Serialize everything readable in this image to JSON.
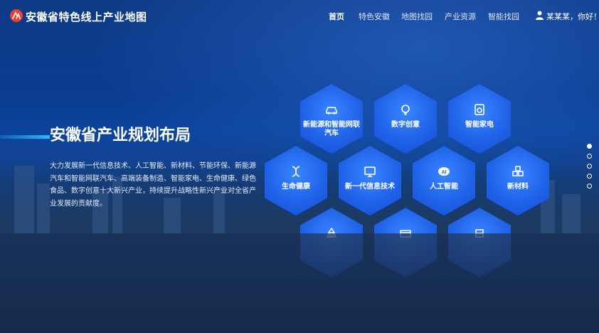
{
  "header": {
    "title": "安徽省特色线上产业地图",
    "nav": [
      {
        "label": "首页",
        "active": true
      },
      {
        "label": "特色安徽",
        "active": false
      },
      {
        "label": "地图找园",
        "active": false
      },
      {
        "label": "产业资源",
        "active": false
      },
      {
        "label": "智能找园",
        "active": false
      }
    ],
    "user_greeting": "某某某，你好！"
  },
  "hero": {
    "title": "安徽省产业规划布局",
    "description": "大力发展新一代信息技术、人工智能、新材料、节能环保、新能源汽车和智能网联汽车、高端装备制造、智能家电、生命健康、绿色食品、数字创意十大新兴产业，持续提升战略性新兴产业对全省产业发展的贡献度。"
  },
  "industries": [
    {
      "label": "新能源和智能网联汽车",
      "icon": "car-icon"
    },
    {
      "label": "数字创意",
      "icon": "bulb-icon"
    },
    {
      "label": "智能家电",
      "icon": "appliance-icon"
    },
    {
      "label": "生命健康",
      "icon": "dna-icon"
    },
    {
      "label": "新一代信息技术",
      "icon": "monitor-icon"
    },
    {
      "label": "人工智能",
      "icon": "ai-icon"
    },
    {
      "label": "新材料",
      "icon": "cubes-icon"
    },
    {
      "label": "",
      "icon": "recycle-icon"
    },
    {
      "label": "",
      "icon": "gear-icon"
    },
    {
      "label": "",
      "icon": "food-icon"
    }
  ],
  "pagination": {
    "total": 5,
    "active_index": 0
  },
  "colors": {
    "accent": "#2fb8ff",
    "hex_fill": "#1f62e8",
    "header_text": "#ffffff"
  }
}
